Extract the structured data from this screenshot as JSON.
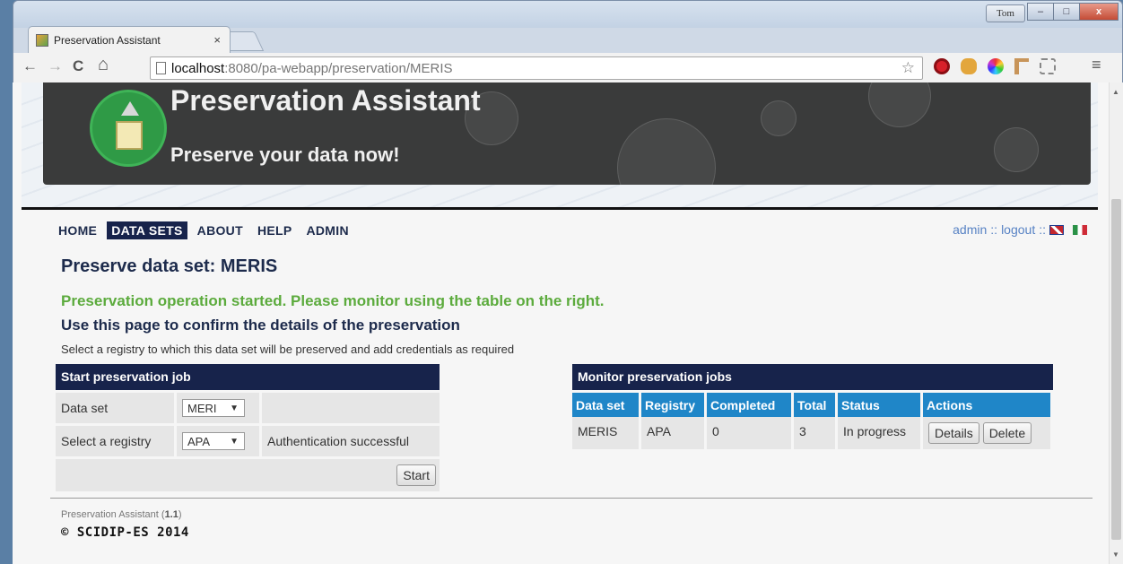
{
  "browser": {
    "tab_title": "Preservation Assistant",
    "tab_close": "×",
    "user_label": "Tom",
    "url_host": "localhost",
    "url_rest": ":8080/pa-webapp/preservation/MERIS",
    "controls": {
      "minimize": "–",
      "maximize": "□",
      "close": "x"
    },
    "nav": {
      "back": "←",
      "forward": "→",
      "reload": "C",
      "home": "⌂",
      "star": "☆",
      "menu": "≡"
    }
  },
  "header": {
    "title": "Preservation Assistant",
    "subtitle": "Preserve your data now!"
  },
  "nav": {
    "items": [
      {
        "label": "HOME",
        "active": false
      },
      {
        "label": "DATA SETS",
        "active": true
      },
      {
        "label": "ABOUT",
        "active": false
      },
      {
        "label": "HELP",
        "active": false
      },
      {
        "label": "ADMIN",
        "active": false
      }
    ],
    "user": "admin",
    "separator": "::",
    "logout": "logout"
  },
  "page": {
    "title": "Preserve data set: MERIS",
    "success": "Preservation operation started. Please monitor using the table on the right.",
    "subheading": "Use this page to confirm the details of the preservation",
    "hint": "Select a registry to which this data set will be preserved and add credentials as required"
  },
  "start_job": {
    "heading": "Start preservation job",
    "dataset_label": "Data set",
    "dataset_value": "MERI",
    "registry_label": "Select a registry",
    "registry_value": "APA",
    "auth_status": "Authentication successful",
    "start_button": "Start"
  },
  "monitor": {
    "heading": "Monitor preservation jobs",
    "columns": [
      "Data set",
      "Registry",
      "Completed",
      "Total",
      "Status",
      "Actions"
    ],
    "rows": [
      {
        "dataset": "MERIS",
        "registry": "APA",
        "completed": "0",
        "total": "3",
        "status": "In progress",
        "details_button": "Details",
        "delete_button": "Delete"
      }
    ]
  },
  "footer": {
    "app_name": "Preservation Assistant",
    "version": "1.1",
    "copyright": "© SCIDIP-ES 2014"
  },
  "colors": {
    "navy": "#17234b",
    "table_header_blue": "#1f86c8",
    "success_green": "#5cab3d",
    "link_blue": "#5782c4"
  }
}
